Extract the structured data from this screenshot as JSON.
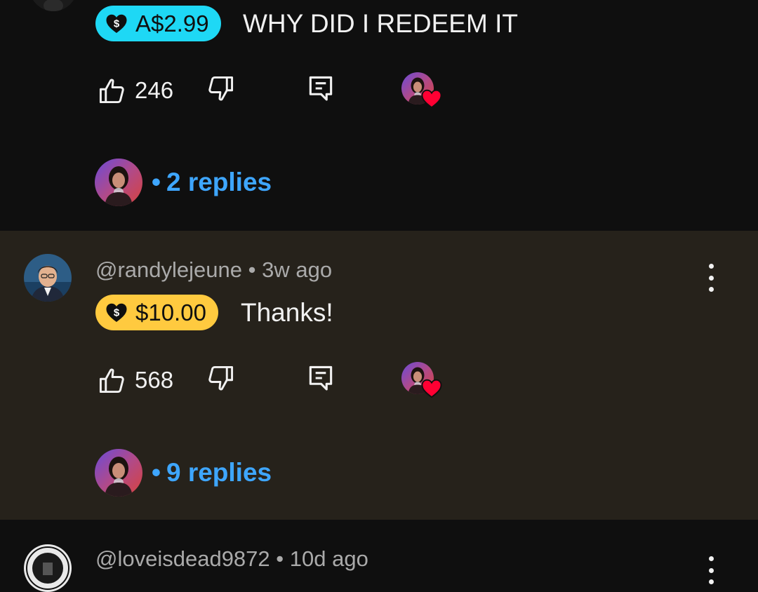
{
  "comments": [
    {
      "superthanks_amount": "A$2.99",
      "superthanks_color": "#1ed8f5",
      "text": "WHY DID I REDEEM IT",
      "likes": "246",
      "reply_count_label": "2 replies"
    },
    {
      "handle": "@randylejeune",
      "separator": "•",
      "time": "3w ago",
      "superthanks_amount": "$10.00",
      "superthanks_color": "#ffca3f",
      "text": "Thanks!",
      "likes": "568",
      "reply_count_label": "9 replies"
    },
    {
      "handle": "@loveisdead9872",
      "separator": "•",
      "time": "10d ago"
    }
  ],
  "reply_bullet": "•",
  "colors": {
    "background": "#0f0f0f",
    "highlighted_background": "#26221b",
    "link_blue": "#3ea6ff",
    "heart_red": "#ff0033",
    "meta_gray": "#aaaaaa"
  },
  "icons": {
    "like": "thumbs-up-icon",
    "dislike": "thumbs-down-icon",
    "reply": "reply-icon",
    "creator_heart": "heart-icon",
    "menu": "more-vert-icon",
    "superthanks": "dollar-heart-icon"
  }
}
